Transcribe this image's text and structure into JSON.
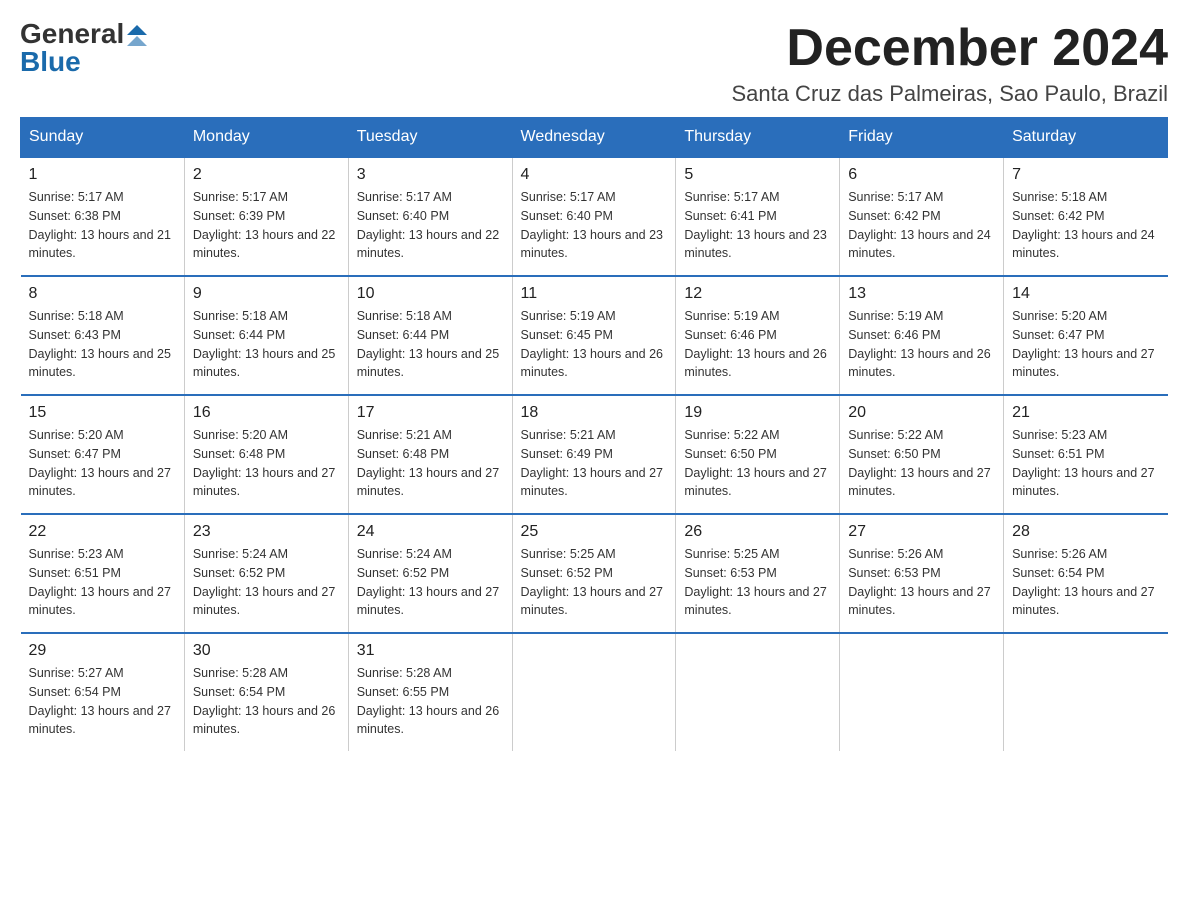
{
  "logo": {
    "general": "General",
    "blue": "Blue"
  },
  "title": "December 2024",
  "location": "Santa Cruz das Palmeiras, Sao Paulo, Brazil",
  "days_of_week": [
    "Sunday",
    "Monday",
    "Tuesday",
    "Wednesday",
    "Thursday",
    "Friday",
    "Saturday"
  ],
  "weeks": [
    [
      {
        "day": "1",
        "sunrise": "5:17 AM",
        "sunset": "6:38 PM",
        "daylight": "13 hours and 21 minutes."
      },
      {
        "day": "2",
        "sunrise": "5:17 AM",
        "sunset": "6:39 PM",
        "daylight": "13 hours and 22 minutes."
      },
      {
        "day": "3",
        "sunrise": "5:17 AM",
        "sunset": "6:40 PM",
        "daylight": "13 hours and 22 minutes."
      },
      {
        "day": "4",
        "sunrise": "5:17 AM",
        "sunset": "6:40 PM",
        "daylight": "13 hours and 23 minutes."
      },
      {
        "day": "5",
        "sunrise": "5:17 AM",
        "sunset": "6:41 PM",
        "daylight": "13 hours and 23 minutes."
      },
      {
        "day": "6",
        "sunrise": "5:17 AM",
        "sunset": "6:42 PM",
        "daylight": "13 hours and 24 minutes."
      },
      {
        "day": "7",
        "sunrise": "5:18 AM",
        "sunset": "6:42 PM",
        "daylight": "13 hours and 24 minutes."
      }
    ],
    [
      {
        "day": "8",
        "sunrise": "5:18 AM",
        "sunset": "6:43 PM",
        "daylight": "13 hours and 25 minutes."
      },
      {
        "day": "9",
        "sunrise": "5:18 AM",
        "sunset": "6:44 PM",
        "daylight": "13 hours and 25 minutes."
      },
      {
        "day": "10",
        "sunrise": "5:18 AM",
        "sunset": "6:44 PM",
        "daylight": "13 hours and 25 minutes."
      },
      {
        "day": "11",
        "sunrise": "5:19 AM",
        "sunset": "6:45 PM",
        "daylight": "13 hours and 26 minutes."
      },
      {
        "day": "12",
        "sunrise": "5:19 AM",
        "sunset": "6:46 PM",
        "daylight": "13 hours and 26 minutes."
      },
      {
        "day": "13",
        "sunrise": "5:19 AM",
        "sunset": "6:46 PM",
        "daylight": "13 hours and 26 minutes."
      },
      {
        "day": "14",
        "sunrise": "5:20 AM",
        "sunset": "6:47 PM",
        "daylight": "13 hours and 27 minutes."
      }
    ],
    [
      {
        "day": "15",
        "sunrise": "5:20 AM",
        "sunset": "6:47 PM",
        "daylight": "13 hours and 27 minutes."
      },
      {
        "day": "16",
        "sunrise": "5:20 AM",
        "sunset": "6:48 PM",
        "daylight": "13 hours and 27 minutes."
      },
      {
        "day": "17",
        "sunrise": "5:21 AM",
        "sunset": "6:48 PM",
        "daylight": "13 hours and 27 minutes."
      },
      {
        "day": "18",
        "sunrise": "5:21 AM",
        "sunset": "6:49 PM",
        "daylight": "13 hours and 27 minutes."
      },
      {
        "day": "19",
        "sunrise": "5:22 AM",
        "sunset": "6:50 PM",
        "daylight": "13 hours and 27 minutes."
      },
      {
        "day": "20",
        "sunrise": "5:22 AM",
        "sunset": "6:50 PM",
        "daylight": "13 hours and 27 minutes."
      },
      {
        "day": "21",
        "sunrise": "5:23 AM",
        "sunset": "6:51 PM",
        "daylight": "13 hours and 27 minutes."
      }
    ],
    [
      {
        "day": "22",
        "sunrise": "5:23 AM",
        "sunset": "6:51 PM",
        "daylight": "13 hours and 27 minutes."
      },
      {
        "day": "23",
        "sunrise": "5:24 AM",
        "sunset": "6:52 PM",
        "daylight": "13 hours and 27 minutes."
      },
      {
        "day": "24",
        "sunrise": "5:24 AM",
        "sunset": "6:52 PM",
        "daylight": "13 hours and 27 minutes."
      },
      {
        "day": "25",
        "sunrise": "5:25 AM",
        "sunset": "6:52 PM",
        "daylight": "13 hours and 27 minutes."
      },
      {
        "day": "26",
        "sunrise": "5:25 AM",
        "sunset": "6:53 PM",
        "daylight": "13 hours and 27 minutes."
      },
      {
        "day": "27",
        "sunrise": "5:26 AM",
        "sunset": "6:53 PM",
        "daylight": "13 hours and 27 minutes."
      },
      {
        "day": "28",
        "sunrise": "5:26 AM",
        "sunset": "6:54 PM",
        "daylight": "13 hours and 27 minutes."
      }
    ],
    [
      {
        "day": "29",
        "sunrise": "5:27 AM",
        "sunset": "6:54 PM",
        "daylight": "13 hours and 27 minutes."
      },
      {
        "day": "30",
        "sunrise": "5:28 AM",
        "sunset": "6:54 PM",
        "daylight": "13 hours and 26 minutes."
      },
      {
        "day": "31",
        "sunrise": "5:28 AM",
        "sunset": "6:55 PM",
        "daylight": "13 hours and 26 minutes."
      },
      null,
      null,
      null,
      null
    ]
  ]
}
